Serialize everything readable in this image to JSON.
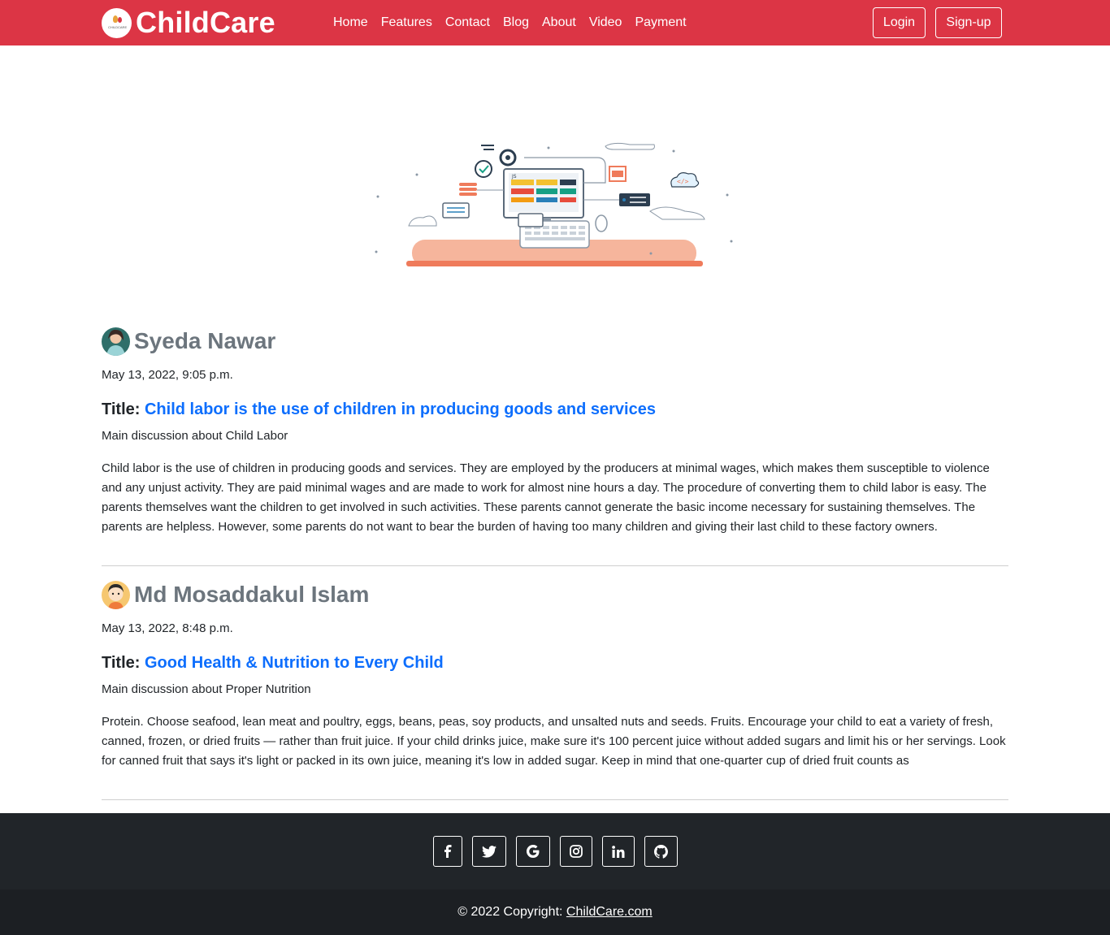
{
  "nav": {
    "brand": "ChildCare",
    "brand_logo_text": "CHILDCARE",
    "links": [
      "Home",
      "Features",
      "Contact",
      "Blog",
      "About",
      "Video",
      "Payment"
    ],
    "login": "Login",
    "signup": "Sign-up"
  },
  "hero": {
    "icon": "web-development-illustration",
    "code_label": "JS"
  },
  "posts": [
    {
      "author": "Syeda Nawar",
      "date": "May 13, 2022, 9:05 p.m.",
      "title_label": "Title:",
      "title": "Child labor is the use of children in producing goods and services",
      "subtitle": "Main discussion about Child Labor",
      "body": "Child labor is the use of children in producing goods and services. They are employed by the producers at minimal wages, which makes them susceptible to violence and any unjust activity. They are paid minimal wages and are made to work for almost nine hours a day. The procedure of converting them to child labor is easy. The parents themselves want the children to get involved in such activities. These parents cannot generate the basic income necessary for sustaining themselves. The parents are helpless. However, some parents do not want to bear the burden of having too many children and giving their last child to these factory owners."
    },
    {
      "author": "Md Mosaddakul Islam",
      "date": "May 13, 2022, 8:48 p.m.",
      "title_label": "Title:",
      "title": "Good Health & Nutrition to Every Child",
      "subtitle": "Main discussion about Proper Nutrition",
      "body": "Protein. Choose seafood, lean meat and poultry, eggs, beans, peas, soy products, and unsalted nuts and seeds. Fruits. Encourage your child to eat a variety of fresh, canned, frozen, or dried fruits — rather than fruit juice. If your child drinks juice, make sure it's 100 percent juice without added sugars and limit his or her servings. Look for canned fruit that says it's light or packed in its own juice, meaning it's low in added sugar. Keep in mind that one-quarter cup of dried fruit counts as"
    }
  ],
  "footer": {
    "socials": [
      {
        "name": "facebook-icon",
        "glyph": "f"
      },
      {
        "name": "twitter-icon",
        "glyph": ""
      },
      {
        "name": "google-icon",
        "glyph": "G"
      },
      {
        "name": "instagram-icon",
        "glyph": ""
      },
      {
        "name": "linkedin-icon",
        "glyph": "in"
      },
      {
        "name": "github-icon",
        "glyph": ""
      }
    ],
    "copyright_prefix": "© 2022 Copyright: ",
    "copyright_link": "ChildCare.com"
  },
  "colors": {
    "navbar": "#dc3545",
    "link": "#0d6efd",
    "muted": "#6c757d",
    "footer_dark": "#212529",
    "footer_darker": "#1c1f23"
  }
}
